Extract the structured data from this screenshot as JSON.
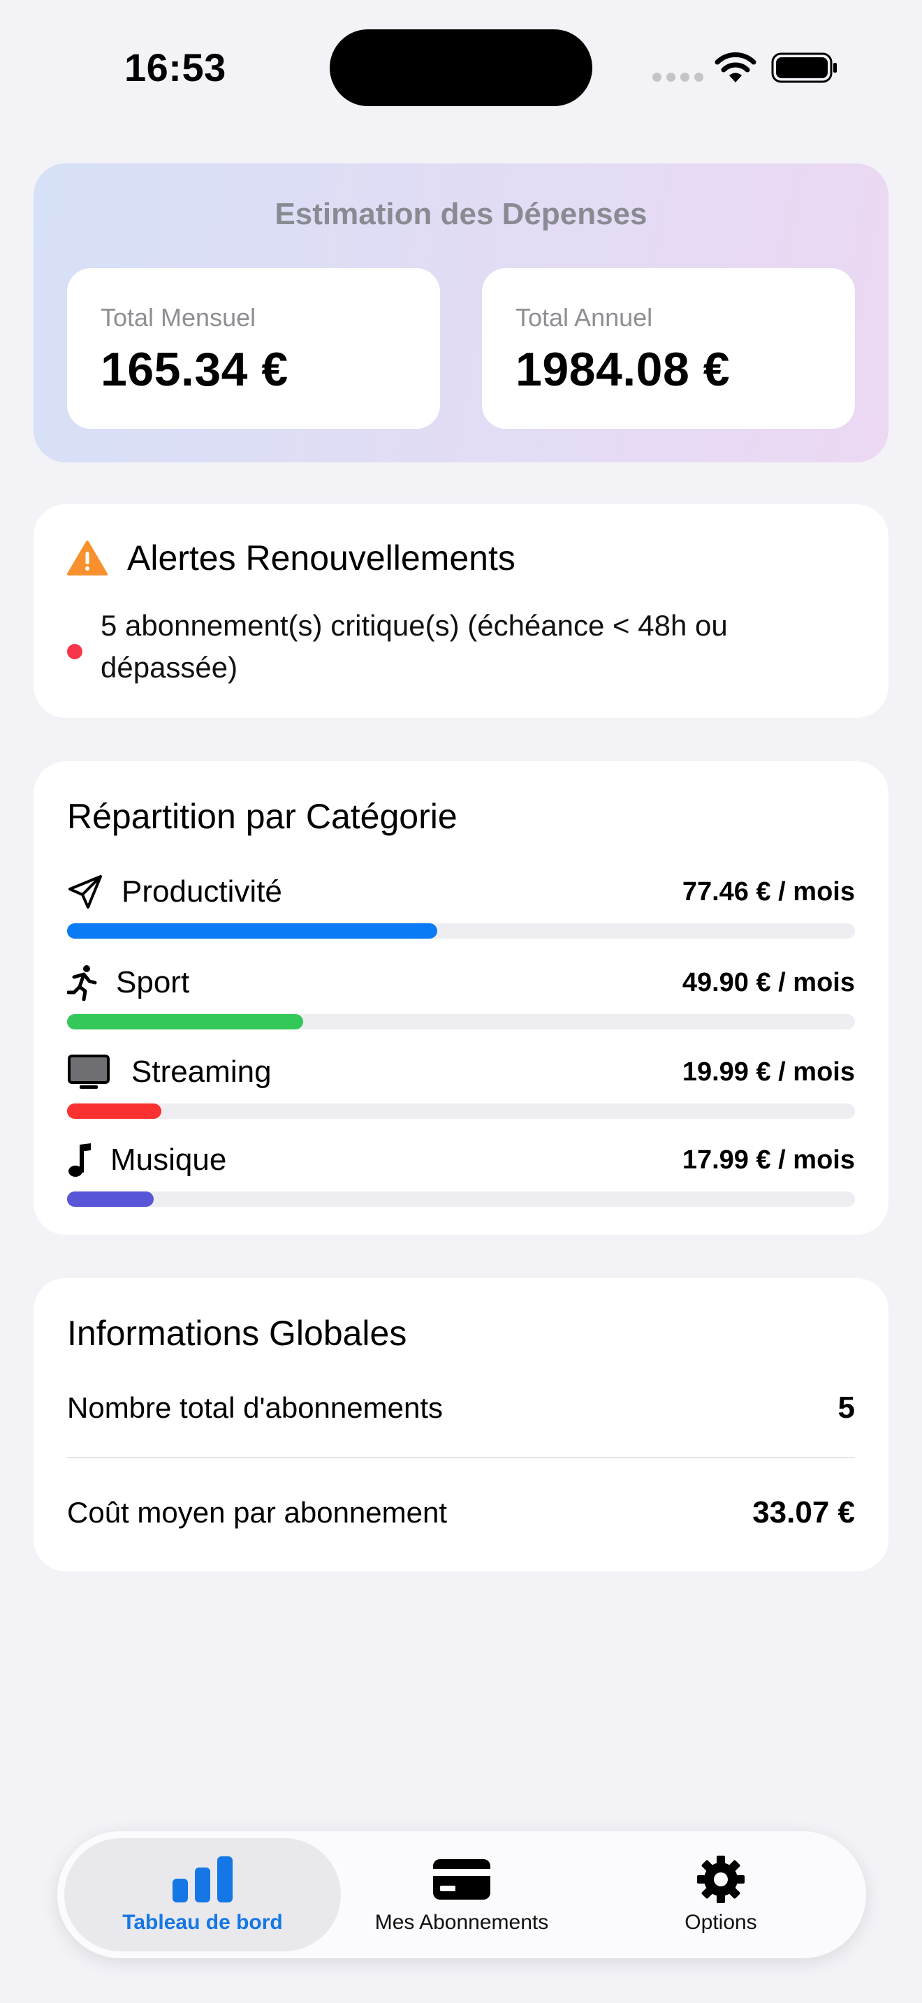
{
  "status": {
    "time": "16:53"
  },
  "estimate": {
    "title": "Estimation des Dépenses",
    "monthly_label": "Total Mensuel",
    "monthly_value": "165.34 €",
    "annual_label": "Total Annuel",
    "annual_value": "1984.08 €"
  },
  "alerts": {
    "title": "Alertes Renouvellements",
    "message": "5 abonnement(s) critique(s) (échéance < 48h ou dépassée)",
    "warning_color": "#f8912d",
    "dot_color": "#f6364b"
  },
  "categories": {
    "title": "Répartition par Catégorie",
    "items": [
      {
        "name": "Productivité",
        "amount": "77.46 € / mois",
        "fraction": 0.47,
        "color": "#0a7af5",
        "icon": "paper-plane-icon"
      },
      {
        "name": "Sport",
        "amount": "49.90 € / mois",
        "fraction": 0.3,
        "color": "#34c759",
        "icon": "running-person-icon"
      },
      {
        "name": "Streaming",
        "amount": "19.99 € / mois",
        "fraction": 0.12,
        "color": "#fa3130",
        "icon": "tv-icon"
      },
      {
        "name": "Musique",
        "amount": "17.99 € / mois",
        "fraction": 0.11,
        "color": "#5856d6",
        "icon": "music-note-icon"
      }
    ]
  },
  "infos": {
    "title": "Informations Globales",
    "count_label": "Nombre total d'abonnements",
    "count_value": "5",
    "avg_label": "Coût moyen par abonnement",
    "avg_value": "33.07 €"
  },
  "tabbar": {
    "active_color": "#1577e5",
    "tabs": [
      {
        "label": "Tableau de bord",
        "icon": "bar-chart-icon",
        "active": true
      },
      {
        "label": "Mes Abonnements",
        "icon": "credit-card-icon",
        "active": false
      },
      {
        "label": "Options",
        "icon": "gear-icon",
        "active": false
      }
    ]
  }
}
